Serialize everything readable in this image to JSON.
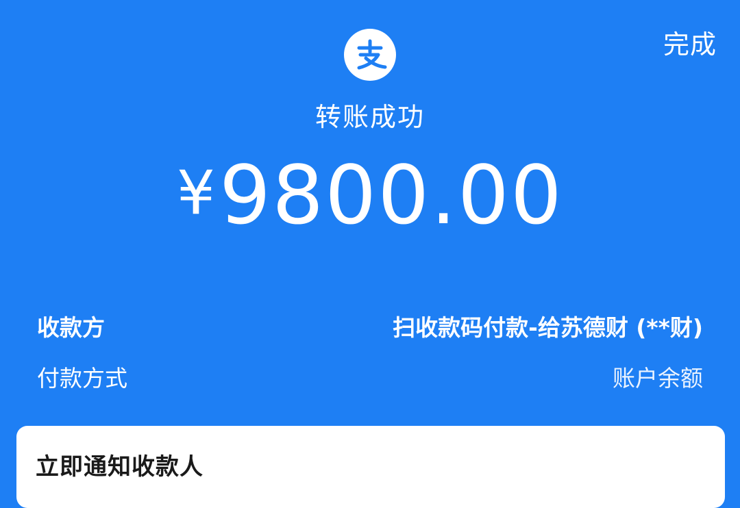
{
  "header": {
    "done_label": "完成",
    "logo_icon": "alipay-logo-icon"
  },
  "status": {
    "title": "转账成功"
  },
  "amount": {
    "currency": "¥",
    "value": "9800.00"
  },
  "details": {
    "payee_label": "收款方",
    "payee_value": "扫收款码付款-给苏德财 (**财)",
    "method_label": "付款方式",
    "method_value": "账户余额"
  },
  "notify_card": {
    "title": "立即通知收款人"
  },
  "colors": {
    "background": "#1e7ff4",
    "text": "#ffffff",
    "card": "#ffffff",
    "card_text": "#1a1a1a"
  }
}
